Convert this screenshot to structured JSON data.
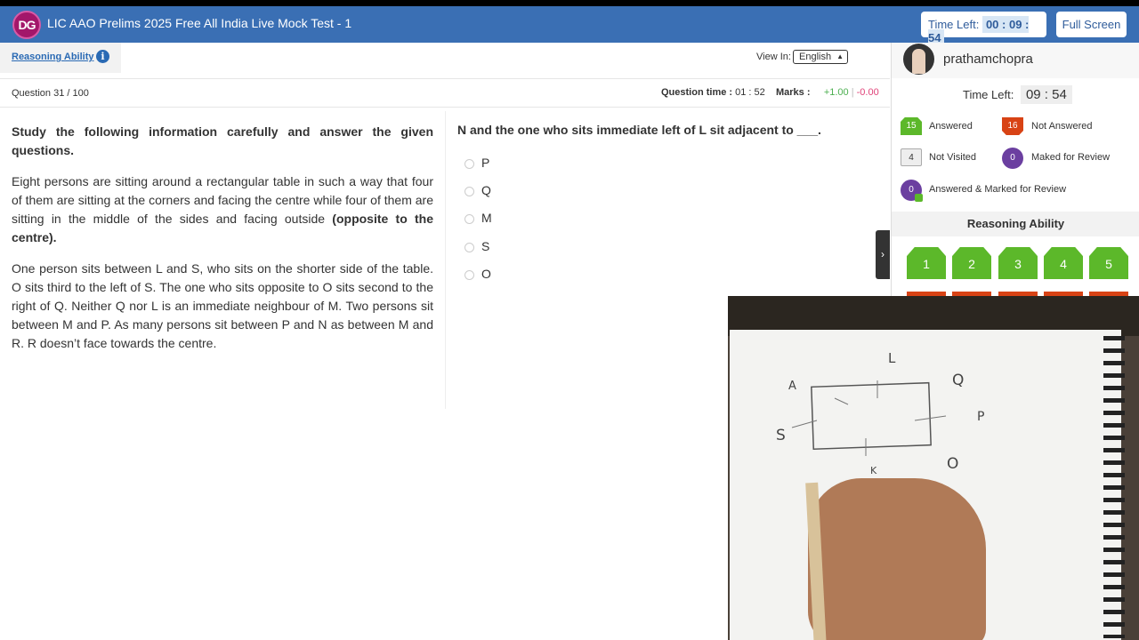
{
  "header": {
    "logo_text": "DG",
    "title": "LIC AAO Prelims 2025 Free All India Live Mock Test - 1",
    "time_left_label": "Time Left:",
    "time_left_value": "00 : 09 : 54",
    "fullscreen_label": "Full Screen"
  },
  "section_tab": {
    "label": "Reasoning Ability",
    "info_icon": "i"
  },
  "view_in": {
    "label": "View In:",
    "selected": "English"
  },
  "question_meta": {
    "number": "Question 31 / 100",
    "time_label": "Question time :",
    "time_value": "01 : 52",
    "marks_label": "Marks :",
    "marks_positive": "+1.00",
    "marks_sep": "|",
    "marks_negative": "-0.00"
  },
  "passage": {
    "heading": "Study the following information carefully and answer the given questions.",
    "para1": "Eight persons are sitting around a rectangular table in such a way that four of them are sitting at the corners and facing the centre while four of them are sitting in the middle of the sides and facing outside",
    "para1_bold": "(opposite to the centre).",
    "para2": "One person sits between L and S, who sits on the shorter side of the table. O sits third to the left of S. The one who sits opposite to O sits second to the right of Q. Neither Q nor L is an immediate neighbour of M. Two persons sit between M and P. As many persons sit between P and N as between M and R. R doesn’t face towards the centre."
  },
  "question": {
    "text": "N and the one who sits immediate left of L sit adjacent to ___.",
    "options": [
      "P",
      "Q",
      "M",
      "S",
      "O"
    ]
  },
  "panel": {
    "username": "prathamchopra",
    "time_left_label": "Time Left:",
    "time_left_value": "09 : 54",
    "legend": {
      "answered_count": "15",
      "answered_label": "Answered",
      "not_answered_count": "16",
      "not_answered_label": "Not Answered",
      "not_visited_count": "4",
      "not_visited_label": "Not Visited",
      "marked_count": "0",
      "marked_label": "Maked for Review",
      "ans_marked_count": "0",
      "ans_marked_label": "Answered & Marked for Review"
    },
    "section_title": "Reasoning Ability",
    "question_buttons": [
      "1",
      "2",
      "3",
      "4",
      "5"
    ],
    "collapse_icon": "›"
  },
  "sketch_labels": [
    "L",
    "Q",
    "A",
    "S",
    "O",
    "P",
    "K"
  ],
  "colors": {
    "header_bg": "#3a6fb4",
    "answered": "#5cb82a",
    "not_answered": "#d84315",
    "review": "#6b3fa0"
  }
}
